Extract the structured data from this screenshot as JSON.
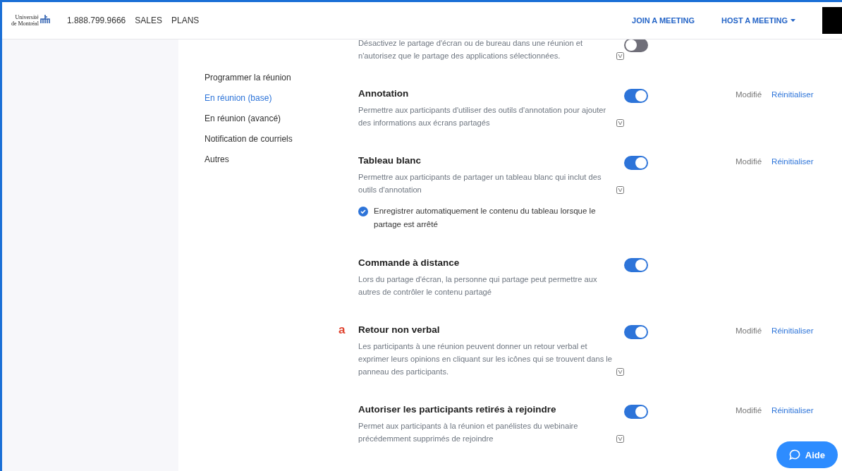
{
  "header": {
    "logo_lines": [
      "Université",
      "de Montréal"
    ],
    "phone": "1.888.799.9666",
    "links": [
      "SALES",
      "PLANS"
    ],
    "actions": [
      {
        "label": "JOIN A MEETING",
        "dropdown": false
      },
      {
        "label": "HOST A MEETING",
        "dropdown": true
      }
    ]
  },
  "sidebar": {
    "items": [
      {
        "label": "Programmer la réunion",
        "selected": false
      },
      {
        "label": "En réunion (base)",
        "selected": true
      },
      {
        "label": "En réunion (avancé)",
        "selected": false
      },
      {
        "label": "Notification de courriels",
        "selected": false
      },
      {
        "label": "Autres",
        "selected": false
      }
    ]
  },
  "settings": [
    {
      "description": "Désactivez le partage d'écran ou de bureau dans une réunion et n'autorisez que le partage des applications sélectionnées.",
      "info_icon": true,
      "on": false
    },
    {
      "title": "Annotation",
      "description": "Permettre aux participants d'utiliser des outils d'annotation pour ajouter des informations aux écrans partagés",
      "info_icon": true,
      "on": true,
      "status": "Modifié",
      "reset": "Réinitialiser"
    },
    {
      "title": "Tableau blanc",
      "description": "Permettre aux participants de partager un tableau blanc qui inclut des outils d'annotation",
      "info_icon": true,
      "on": true,
      "status": "Modifié",
      "reset": "Réinitialiser",
      "option": {
        "label": "Enregistrer automatiquement le contenu du tableau lorsque le partage est arrêté",
        "checked": true
      }
    },
    {
      "title": "Commande à distance",
      "description": "Lors du partage d'écran, la personne qui partage peut permettre aux autres de contrôler le contenu partagé",
      "info_icon": false,
      "on": true
    },
    {
      "marker": "a",
      "title": "Retour non verbal",
      "description": "Les participants à une réunion peuvent donner un retour verbal et exprimer leurs opinions en cliquant sur les icônes qui se trouvent dans le panneau des participants.",
      "info_icon": true,
      "on": true,
      "status": "Modifié",
      "reset": "Réinitialiser"
    },
    {
      "title": "Autoriser les participants retirés à rejoindre",
      "description": "Permet aux participants à la réunion et panélistes du webinaire précédemment supprimés de rejoindre",
      "info_icon": true,
      "on": true,
      "status": "Modifié",
      "reset": "Réinitialiser"
    }
  ],
  "help_button": "Aide"
}
